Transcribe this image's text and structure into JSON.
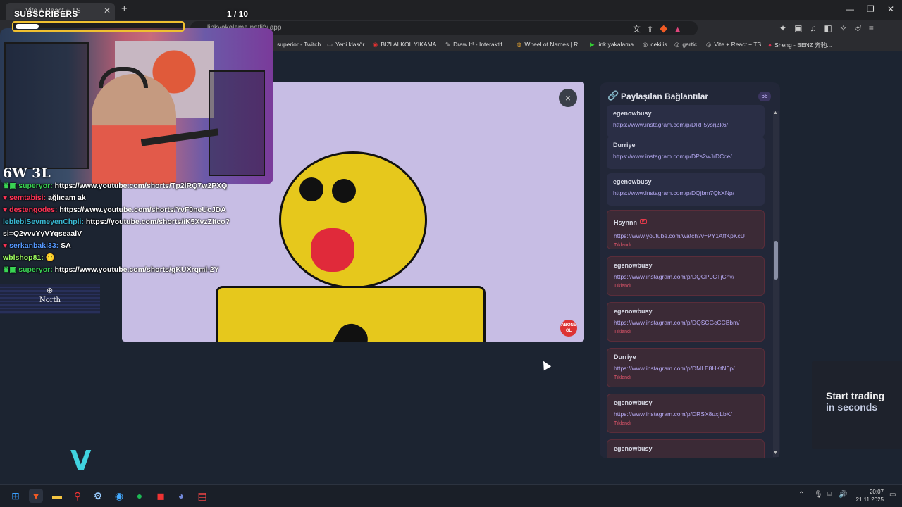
{
  "browser": {
    "tab_title": "Vite + React + TS",
    "url": "linkyakalama.netlify.app",
    "bookmarks": [
      {
        "label": "superior - Twitch",
        "icon": "folder-icon"
      },
      {
        "label": "Yeni klasör",
        "icon": "folder-icon"
      },
      {
        "label": "BIZI ALKOL YIKAMA...",
        "icon": "bookmark-icon"
      },
      {
        "label": "Draw It! - İnteraktif...",
        "icon": "bookmark-icon"
      },
      {
        "label": "Wheel of Names | R...",
        "icon": "bookmark-icon"
      },
      {
        "label": "link yakalama",
        "icon": "bookmark-icon"
      },
      {
        "label": "cekilis",
        "icon": "bookmark-icon"
      },
      {
        "label": "gartic",
        "icon": "bookmark-icon"
      },
      {
        "label": "Vite + React + TS",
        "icon": "bookmark-icon"
      },
      {
        "label": "Sheng - BENZ 奔驰...",
        "icon": "bookmark-icon"
      }
    ]
  },
  "stream_overlay": {
    "subscribers_label": "SUBSCRIBERS",
    "sub_count": "1  / 10",
    "sub_progress": 0.1,
    "score": "6W 3L",
    "north_label": "North",
    "chat": [
      {
        "user": "superyor:",
        "message": "https://www.youtube.com/shorts/Tp2lRQ7w2PXQ",
        "color": "green"
      },
      {
        "user": "semtabisi:",
        "message": "ağlıcam ak",
        "color": "red"
      },
      {
        "user": "destengodes:",
        "message": "https://www.youtube.com/shorts/YvF0neUcJDA",
        "color": "red"
      },
      {
        "user": "leblebiSevmeyenChpli:",
        "message": "https://youtube.com/shorts/iK5XvzZItco?",
        "color": "cyan"
      },
      {
        "user": "",
        "message": "si=Q2vvvYyVYqseaalV",
        "color": "white"
      },
      {
        "user": "serkanbaki33:",
        "message": "SA",
        "color": "blue"
      },
      {
        "user": "wblshop81:",
        "message": "😶",
        "color": "lime"
      },
      {
        "user": "superyor:",
        "message": "https://www.youtube.com/shorts/gKUXrqml-2Y",
        "color": "green"
      }
    ]
  },
  "video": {
    "close_label": "×",
    "abone_badge": "ABONE OL"
  },
  "panel": {
    "title": "Paylaşılan Bağlantılar",
    "count": "66",
    "items": [
      {
        "user": "egenowbusy",
        "link": "https://www.instagram.com/p/DRF5ysrjZk6/",
        "clicked": false,
        "tag": ""
      },
      {
        "user": "Durriye",
        "link": "https://www.instagram.com/p/DPs2wJrDCce/",
        "clicked": false,
        "tag": ""
      },
      {
        "user": "egenowbusy",
        "link": "https://www.instagram.com/p/DQjbm7QkXNp/",
        "clicked": false,
        "tag": ""
      },
      {
        "user": "Hsynnn",
        "link": "https://www.youtube.com/watch?v=PY1AtfKpKcU",
        "clicked": true,
        "tag": "Tıklandı",
        "youtube": true
      },
      {
        "user": "egenowbusy",
        "link": "https://www.instagram.com/p/DQCP0CTjCnv/",
        "clicked": true,
        "tag": "Tıklandı"
      },
      {
        "user": "egenowbusy",
        "link": "https://www.instagram.com/p/DQSCGcCCBbm/",
        "clicked": true,
        "tag": "Tıklandı"
      },
      {
        "user": "Durriye",
        "link": "https://www.instagram.com/p/DMLE8HKtN0p/",
        "clicked": true,
        "tag": "Tıklandı"
      },
      {
        "user": "egenowbusy",
        "link": "https://www.instagram.com/p/DRSX8uxjLbK/",
        "clicked": true,
        "tag": "Tıklandı"
      },
      {
        "user": "egenowbusy",
        "link": "",
        "clicked": true,
        "tag": ""
      }
    ]
  },
  "ad": {
    "line1": "Start trading",
    "line2": "in seconds"
  },
  "taskbar": {
    "time": "20:07",
    "date": "21.11.2025"
  }
}
